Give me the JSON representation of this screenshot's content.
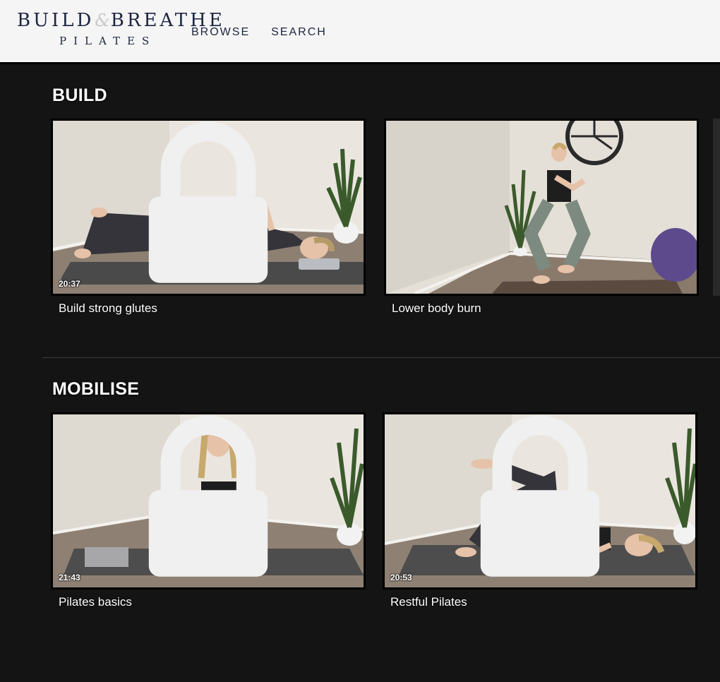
{
  "brand": {
    "logo_word1": "BUILD",
    "logo_amp": "&",
    "logo_word2": "BREATHE",
    "logo_sub": "PILATES"
  },
  "nav": {
    "browse": "BROWSE",
    "search": "SEARCH"
  },
  "sections": [
    {
      "title": "BUILD",
      "videos": [
        {
          "title": "Build strong glutes",
          "duration": "20:37",
          "locked": true
        },
        {
          "title": "Lower body burn",
          "duration": "",
          "locked": false
        }
      ]
    },
    {
      "title": "MOBILISE",
      "videos": [
        {
          "title": "Pilates basics",
          "duration": "21:43",
          "locked": true
        },
        {
          "title": "Restful Pilates",
          "duration": "20:53",
          "locked": true
        }
      ]
    }
  ],
  "icons": {
    "lock": "lock-icon"
  },
  "colors": {
    "page_bg": "#141414",
    "header_bg": "#f5f5f5",
    "brand_navy": "#1c2540",
    "text": "#ffffff"
  }
}
